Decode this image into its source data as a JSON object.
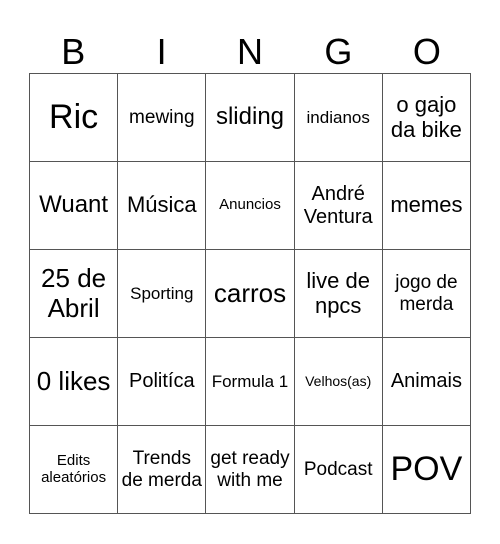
{
  "header": {
    "letters": [
      "B",
      "I",
      "N",
      "G",
      "O"
    ]
  },
  "cells": [
    [
      "Ric",
      "mewing",
      "sliding",
      "indianos",
      "o gajo da bike"
    ],
    [
      "Wuant",
      "Música",
      "Anuncios",
      "André Ventura",
      "memes"
    ],
    [
      "25 de Abril",
      "Sporting",
      "carros",
      "live de npcs",
      "jogo de merda"
    ],
    [
      "0 likes",
      "Politíca",
      "Formula 1",
      "Velhos(as)",
      "Animais"
    ],
    [
      "Edits aleatórios",
      "Trends de merda",
      "get ready with me",
      "Podcast",
      "POV"
    ]
  ]
}
